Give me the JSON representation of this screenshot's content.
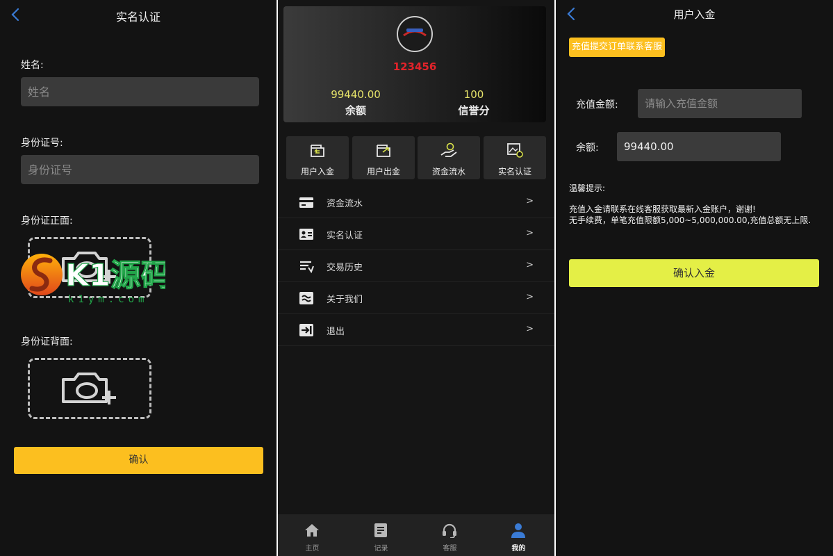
{
  "verify": {
    "title": "实名认证",
    "name_label": "姓名:",
    "name_placeholder": "姓名",
    "id_label": "身份证号:",
    "id_placeholder": "身份证号",
    "front_label": "身份证正面:",
    "back_label": "身份证背面:",
    "confirm_label": "确认"
  },
  "watermark": {
    "brand": "K1源码",
    "url": "k1ym.com"
  },
  "account": {
    "user_id": "123456",
    "balance_value": "99440.00",
    "balance_label": "余额",
    "credit_value": "100",
    "credit_label": "信誉分",
    "quick_actions": [
      {
        "label": "用户入金",
        "icon": "wallet-in-icon"
      },
      {
        "label": "用户出金",
        "icon": "wallet-out-icon"
      },
      {
        "label": "资金流水",
        "icon": "hand-money-icon"
      },
      {
        "label": "实名认证",
        "icon": "id-photo-icon"
      }
    ],
    "menu": [
      {
        "label": "资金流水",
        "icon": "card-icon",
        "chevron": ">"
      },
      {
        "label": "实名认证",
        "icon": "id-card-icon",
        "chevron": ">"
      },
      {
        "label": "交易历史",
        "icon": "history-icon",
        "chevron": ">"
      },
      {
        "label": "关于我们",
        "icon": "about-icon",
        "chevron": ">"
      },
      {
        "label": "退出",
        "icon": "logout-icon",
        "chevron": ">"
      }
    ],
    "tabs": [
      {
        "label": "主页",
        "icon": "home-icon",
        "active": false
      },
      {
        "label": "记录",
        "icon": "records-icon",
        "active": false
      },
      {
        "label": "客服",
        "icon": "headset-icon",
        "active": false
      },
      {
        "label": "我的",
        "icon": "user-icon",
        "active": true
      }
    ]
  },
  "deposit": {
    "title": "用户入金",
    "badge": "充值提交订单联系客服",
    "amount_label": "充值金额:",
    "amount_placeholder": "请输入充值金额",
    "balance_label": "余额:",
    "balance_value": "99440.00",
    "tip_title": "温馨提示:",
    "tip_line1": "充值入金请联系在线客服获取最新入金账户，谢谢!",
    "tip_line2": "无手续费，单笔充值限额5,000~5,000,000.00,充值总额无上限.",
    "confirm_label": "确认入金"
  },
  "colors": {
    "accent_yellow": "#fcbf1f",
    "accent_lime": "#e4ef46",
    "uid_red": "#e2232a",
    "stat_yellow": "#e6e36a",
    "back_blue": "#3a7bd5"
  }
}
